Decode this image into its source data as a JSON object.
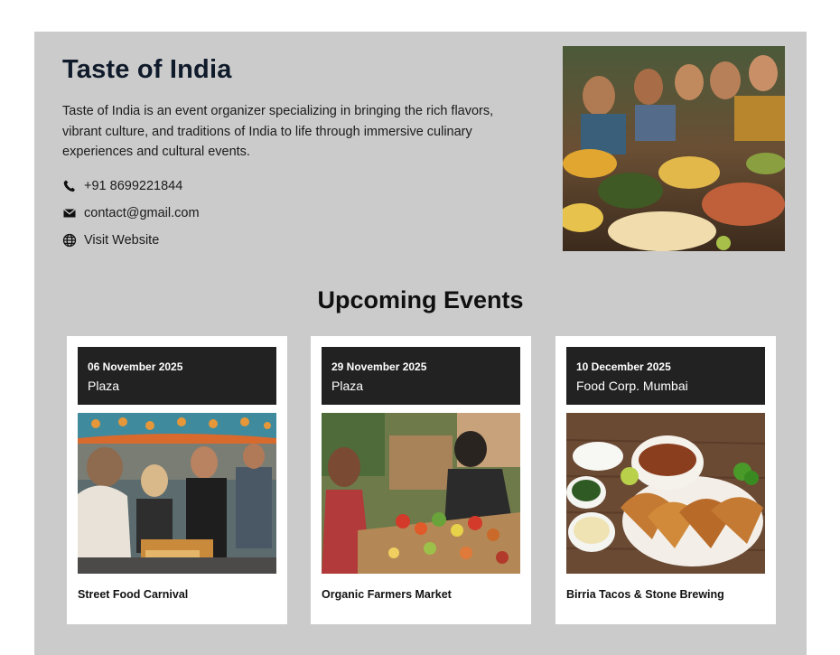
{
  "organizer": {
    "name": "Taste of India",
    "description": "Taste of India is an event organizer specializing in bringing the rich flavors, vibrant culture, and traditions of India to life through immersive culinary experiences and cultural events.",
    "phone": "+91 8699221844",
    "email": "contact@gmail.com",
    "website_label": "Visit Website",
    "icons": [
      "phone-icon",
      "mail-icon",
      "globe-icon"
    ]
  },
  "events_section": {
    "title": "Upcoming Events",
    "events": [
      {
        "date": "06 November 2025",
        "venue": "Plaza",
        "name": "Street Food Carnival"
      },
      {
        "date": "29 November 2025",
        "venue": "Plaza",
        "name": "Organic Farmers Market"
      },
      {
        "date": "10 December 2025",
        "venue": "Food Corp. Mumbai",
        "name": "Birria Tacos & Stone Brewing"
      }
    ]
  },
  "colors": {
    "panel": "#cbcbcb",
    "card_header": "#222222",
    "title": "#0f1a2a"
  }
}
